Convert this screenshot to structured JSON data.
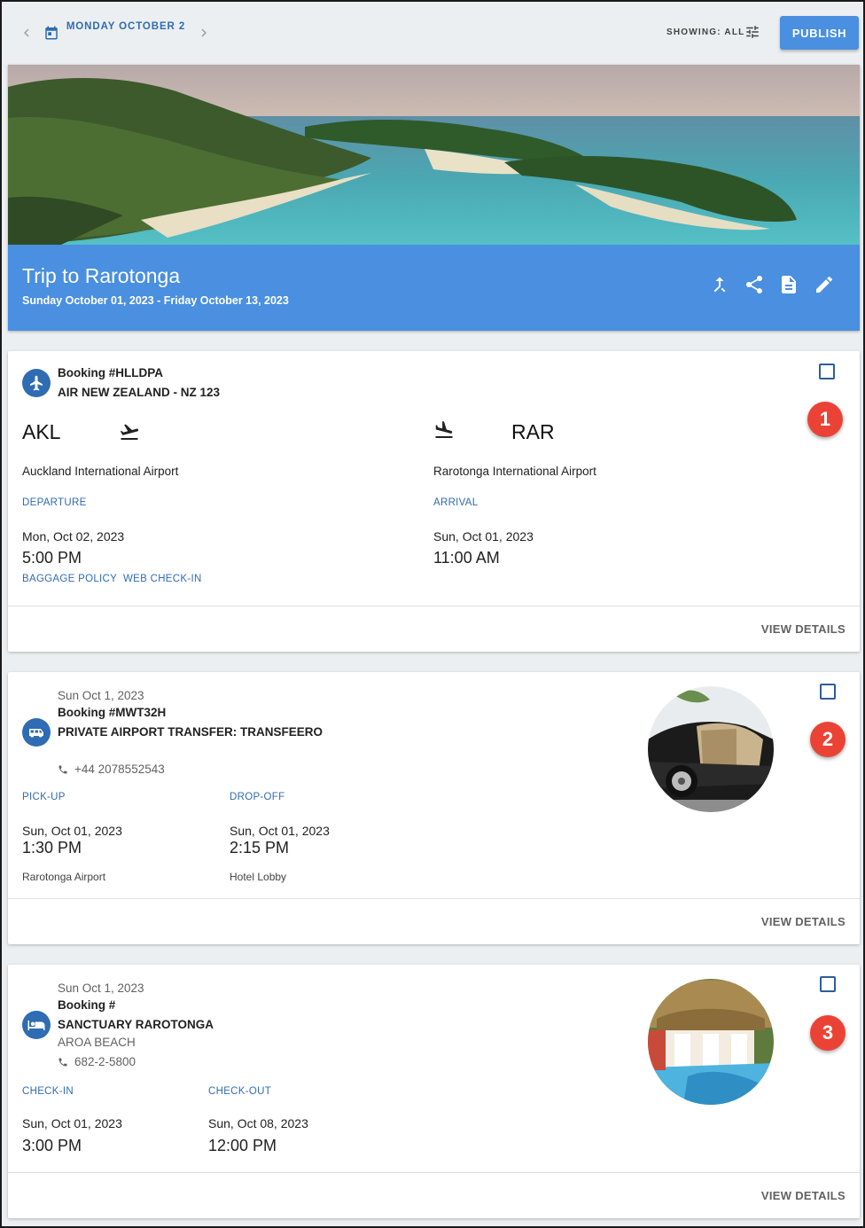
{
  "header": {
    "date_label": "MONDAY OCTOBER 2",
    "showing_label": "SHOWING: ALL",
    "publish_label": "PUBLISH"
  },
  "trip": {
    "title": "Trip to Rarotonga",
    "dates": "Sunday October 01, 2023 - Friday October 13, 2023",
    "actions": [
      "merge-icon",
      "share-icon",
      "document-icon",
      "edit-icon"
    ]
  },
  "flight": {
    "booking": "Booking #HLLDPA",
    "carrier": "AIR NEW ZEALAND - NZ 123",
    "origin_code": "AKL",
    "origin_airport": "Auckland International Airport",
    "destination_code": "RAR",
    "destination_airport": "Rarotonga International Airport",
    "departure_label": "DEPARTURE",
    "departure_date": "Mon, Oct 02, 2023",
    "departure_time": "5:00 PM",
    "arrival_label": "ARRIVAL",
    "arrival_date": "Sun, Oct 01, 2023",
    "arrival_time": "11:00 AM",
    "baggage_link": "BAGGAGE POLICY",
    "checkin_link": "WEB CHECK-IN",
    "view_details": "VIEW DETAILS",
    "marker": "1"
  },
  "transfer": {
    "date": "Sun Oct 1, 2023",
    "booking": "Booking #MWT32H",
    "name": "PRIVATE AIRPORT TRANSFER: TRANSFEERO",
    "phone": "+44 2078552543",
    "pickup_label": "PICK-UP",
    "pickup_date": "Sun, Oct 01, 2023",
    "pickup_time": "1:30 PM",
    "pickup_place": "Rarotonga Airport",
    "dropoff_label": "DROP-OFF",
    "dropoff_date": "Sun, Oct 01, 2023",
    "dropoff_time": "2:15 PM",
    "dropoff_place": "Hotel Lobby",
    "view_details": "VIEW DETAILS",
    "marker": "2"
  },
  "hotel": {
    "date": "Sun Oct 1, 2023",
    "booking": "Booking #",
    "name": "SANCTUARY RAROTONGA",
    "location": "AROA BEACH",
    "phone": "682-2-5800",
    "checkin_label": "CHECK-IN",
    "checkin_date": "Sun, Oct 01, 2023",
    "checkin_time": "3:00 PM",
    "checkout_label": "CHECK-OUT",
    "checkout_date": "Sun, Oct 08, 2023",
    "checkout_time": "12:00 PM",
    "view_details": "VIEW DETAILS",
    "marker": "3"
  },
  "colors": {
    "accent": "#4a8fe0",
    "link": "#2f6cb3",
    "marker": "#ea4335",
    "background": "#eceff1"
  }
}
